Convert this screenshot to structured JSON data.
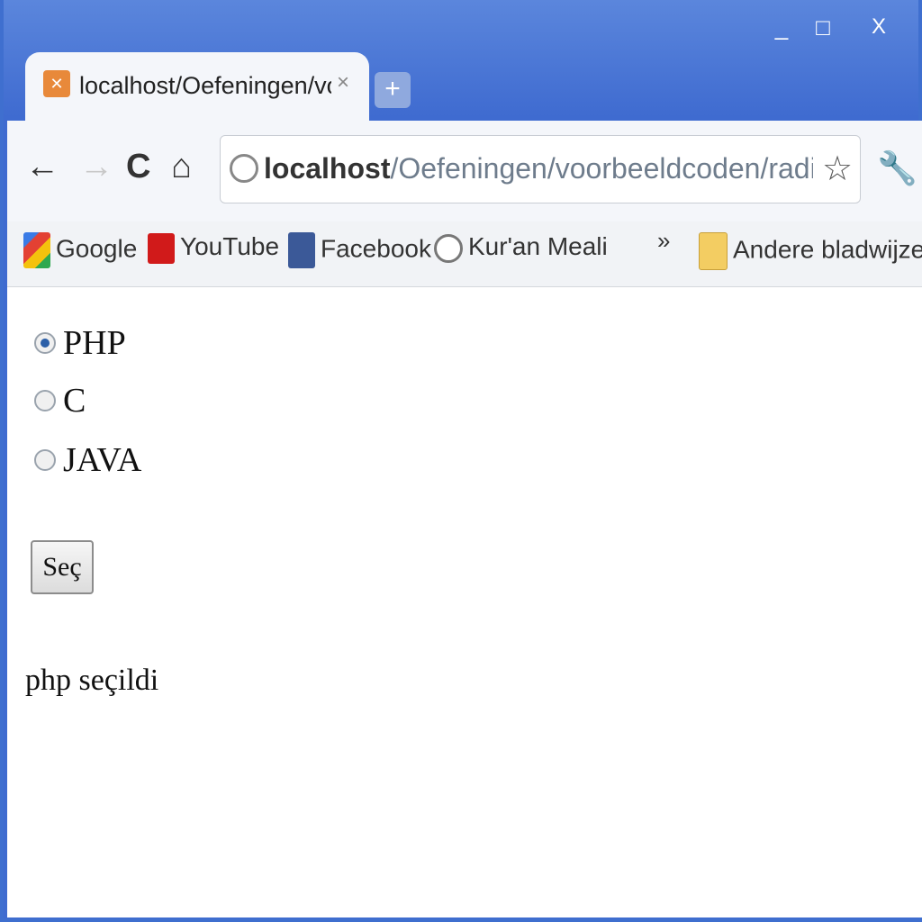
{
  "window": {
    "controls": {
      "minimize": "_",
      "maximize": "□",
      "close": "X"
    }
  },
  "tab": {
    "title": "localhost/Oefeningen/voor",
    "close": "×",
    "new_tab": "+"
  },
  "toolbar": {
    "back": "←",
    "forward": "→",
    "reload": "C",
    "home": "⌂",
    "url_host": "localhost",
    "url_path": "/Oefeningen/voorbeeldcoden/radioBut",
    "star": "☆",
    "wrench": "🔧"
  },
  "bookmarks": {
    "items": [
      {
        "label": "Google",
        "icon": "google-icon"
      },
      {
        "label": "YouTube",
        "icon": "youtube-icon"
      },
      {
        "label": "Facebook",
        "icon": "facebook-icon"
      },
      {
        "label": "Kur'an Meali",
        "icon": "globe-icon"
      }
    ],
    "overflow": "»",
    "other": "Andere bladwijzers"
  },
  "form": {
    "options": [
      {
        "label": "PHP",
        "checked": true
      },
      {
        "label": "C",
        "checked": false
      },
      {
        "label": "JAVA",
        "checked": false
      }
    ],
    "submit_label": "Seç",
    "result_text": "php seçildi"
  }
}
